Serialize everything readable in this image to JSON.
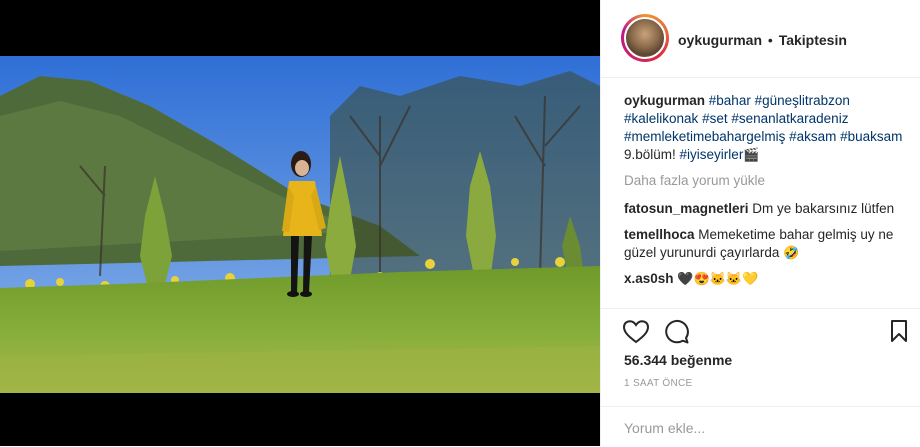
{
  "post": {
    "username": "oykugurman",
    "separator": "•",
    "follow_status": "Takiptesin",
    "caption_user": "oykugurman",
    "caption_tags": [
      "#bahar",
      "#güneşlitrabzon",
      "#kalelikonak",
      "#set",
      "#senanlatkaradeniz",
      "#memleketimebahargelmiş",
      "#aksam",
      "#buaksam"
    ],
    "caption_text_mid": "9.bölüm!",
    "caption_tag_last": "#iyiseyirler",
    "caption_emoji": "🎬",
    "load_more": "Daha fazla yorum yükle",
    "comments": [
      {
        "user": "fatosun_magnetleri",
        "text": "Dm ye bakarsınız lütfen"
      },
      {
        "user": "temellhoca",
        "text": "Memeketime bahar gelmiş uy ne güzel yurunurdi çayırlarda",
        "emoji": "🤣"
      },
      {
        "user": "x.as0sh",
        "text": "🖤😍🐱🐱💛"
      }
    ],
    "likes": "56.344 beğenme",
    "timestamp": "1 SAAT ÖNCE",
    "comment_placeholder": "Yorum ekle..."
  },
  "icons": {
    "like": "heart-icon",
    "comment": "comment-icon",
    "save": "bookmark-icon"
  },
  "colors": {
    "hashtag": "#003569",
    "muted": "#999999",
    "text": "#262626",
    "border": "#efefef",
    "letterbox": "#000000"
  }
}
